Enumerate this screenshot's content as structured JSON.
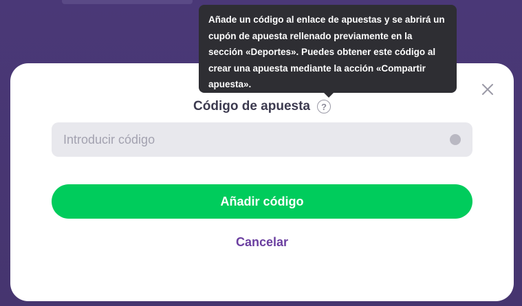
{
  "tooltip": {
    "text": "Añade un código al enlace de apuestas y se abrirá un cupón de apuesta rellenado previamente en la sección «Deportes». Puedes obtener este código al crear una apuesta mediante la acción «Compartir apuesta»."
  },
  "modal": {
    "field_label": "Código de apuesta",
    "help_icon_glyph": "?",
    "input": {
      "value": "",
      "placeholder": "Introducir código"
    },
    "add_button_label": "Añadir código",
    "cancel_label": "Cancelar"
  },
  "colors": {
    "backdrop": "#4b3a78",
    "primary_button": "#00cc5c",
    "cancel_link": "#6b3fa0",
    "tooltip_bg": "#2e2e33",
    "input_bg": "#e8e8ed"
  },
  "icons": {
    "close": "close-icon",
    "help": "question-circle-icon",
    "input_status": "status-dot-icon"
  }
}
